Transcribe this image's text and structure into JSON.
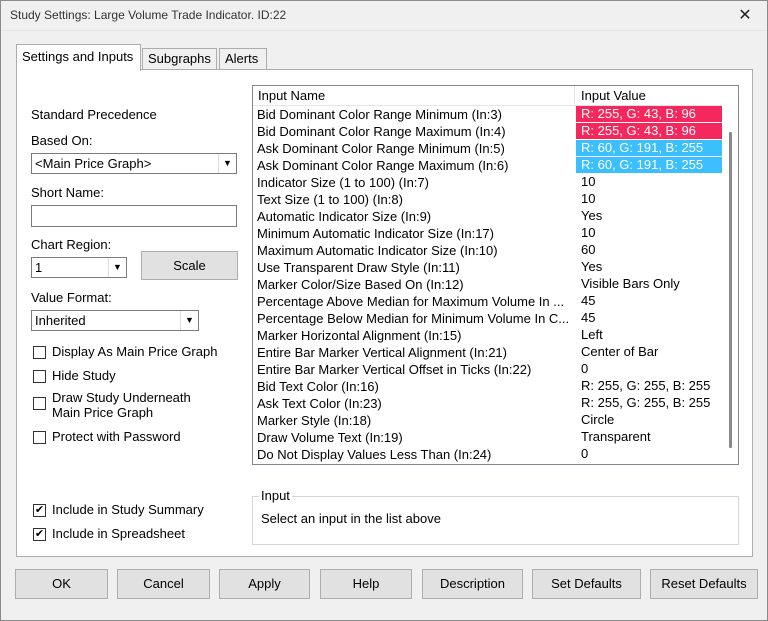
{
  "window": {
    "title": "Study Settings: Large Volume Trade Indicator. ID:22",
    "close_glyph": "✕"
  },
  "tabs": [
    {
      "label": "Settings and Inputs",
      "active": true
    },
    {
      "label": "Subgraphs",
      "active": false
    },
    {
      "label": "Alerts",
      "active": false
    }
  ],
  "left": {
    "standard_precedence": "Standard Precedence",
    "based_on_label": "Based On:",
    "based_on_value": "<Main Price Graph>",
    "short_name_label": "Short Name:",
    "short_name_value": "",
    "chart_region_label": "Chart Region:",
    "chart_region_value": "1",
    "scale_button": "Scale",
    "value_format_label": "Value Format:",
    "value_format_value": "Inherited",
    "checkboxes": {
      "display_main": {
        "label": "Display As Main Price Graph",
        "checked": false
      },
      "hide_study": {
        "label": "Hide Study",
        "checked": false
      },
      "draw_underneath_1": "Draw Study Underneath",
      "draw_underneath_2": "Main Price Graph",
      "draw_underneath_checked": false,
      "protect": {
        "label": "Protect with Password",
        "checked": false
      },
      "summary": {
        "label": "Include in Study Summary",
        "checked": true
      },
      "spreadsheet": {
        "label": "Include in Spreadsheet",
        "checked": true
      }
    }
  },
  "inputs": {
    "columns": [
      "Input Name",
      "Input Value"
    ],
    "rows": [
      {
        "name": "Bid Dominant Color Range Minimum   (In:3)",
        "value": "R: 255, G: 43, B: 96",
        "bg": "#f5285e"
      },
      {
        "name": "Bid Dominant Color Range Maximum   (In:4)",
        "value": "R: 255, G: 43, B: 96",
        "bg": "#f5285e"
      },
      {
        "name": "Ask Dominant Color Range Minimum   (In:5)",
        "value": "R: 60, G: 191, B: 255",
        "bg": "#3cbfff"
      },
      {
        "name": "Ask Dominant Color Range Maximum   (In:6)",
        "value": "R: 60, G: 191, B: 255",
        "bg": "#3cbfff"
      },
      {
        "name": "Indicator Size (1 to 100)   (In:7)",
        "value": "10"
      },
      {
        "name": "Text Size (1 to 100)   (In:8)",
        "value": "10"
      },
      {
        "name": "Automatic Indicator Size   (In:9)",
        "value": "Yes"
      },
      {
        "name": "Minimum Automatic Indicator Size   (In:17)",
        "value": "10"
      },
      {
        "name": "Maximum Automatic Indicator Size   (In:10)",
        "value": "60"
      },
      {
        "name": "Use Transparent Draw Style   (In:11)",
        "value": "Yes"
      },
      {
        "name": "Marker Color/Size Based On   (In:12)",
        "value": "Visible Bars Only"
      },
      {
        "name": "Percentage Above Median for Maximum Volume In ...",
        "value": "45"
      },
      {
        "name": "Percentage Below Median for Minimum Volume In C...",
        "value": "45"
      },
      {
        "name": "Marker Horizontal Alignment   (In:15)",
        "value": "Left"
      },
      {
        "name": "Entire Bar Marker Vertical Alignment   (In:21)",
        "value": "Center of Bar"
      },
      {
        "name": "Entire Bar Marker Vertical Offset in Ticks   (In:22)",
        "value": "0"
      },
      {
        "name": "Bid Text Color   (In:16)",
        "value": "R: 255, G: 255, B: 255"
      },
      {
        "name": "Ask Text Color   (In:23)",
        "value": "R: 255, G: 255, B: 255"
      },
      {
        "name": "Marker Style   (In:18)",
        "value": "Circle"
      },
      {
        "name": "Draw Volume Text   (In:19)",
        "value": "Transparent"
      },
      {
        "name": "Do Not Display Values Less Than   (In:24)",
        "value": "0"
      }
    ]
  },
  "input_group": {
    "legend": "Input",
    "description": "Select an input in the list above"
  },
  "buttons": {
    "ok": "OK",
    "cancel": "Cancel",
    "apply": "Apply",
    "help": "Help",
    "description": "Description",
    "set_defaults": "Set Defaults",
    "reset_defaults": "Reset Defaults"
  }
}
